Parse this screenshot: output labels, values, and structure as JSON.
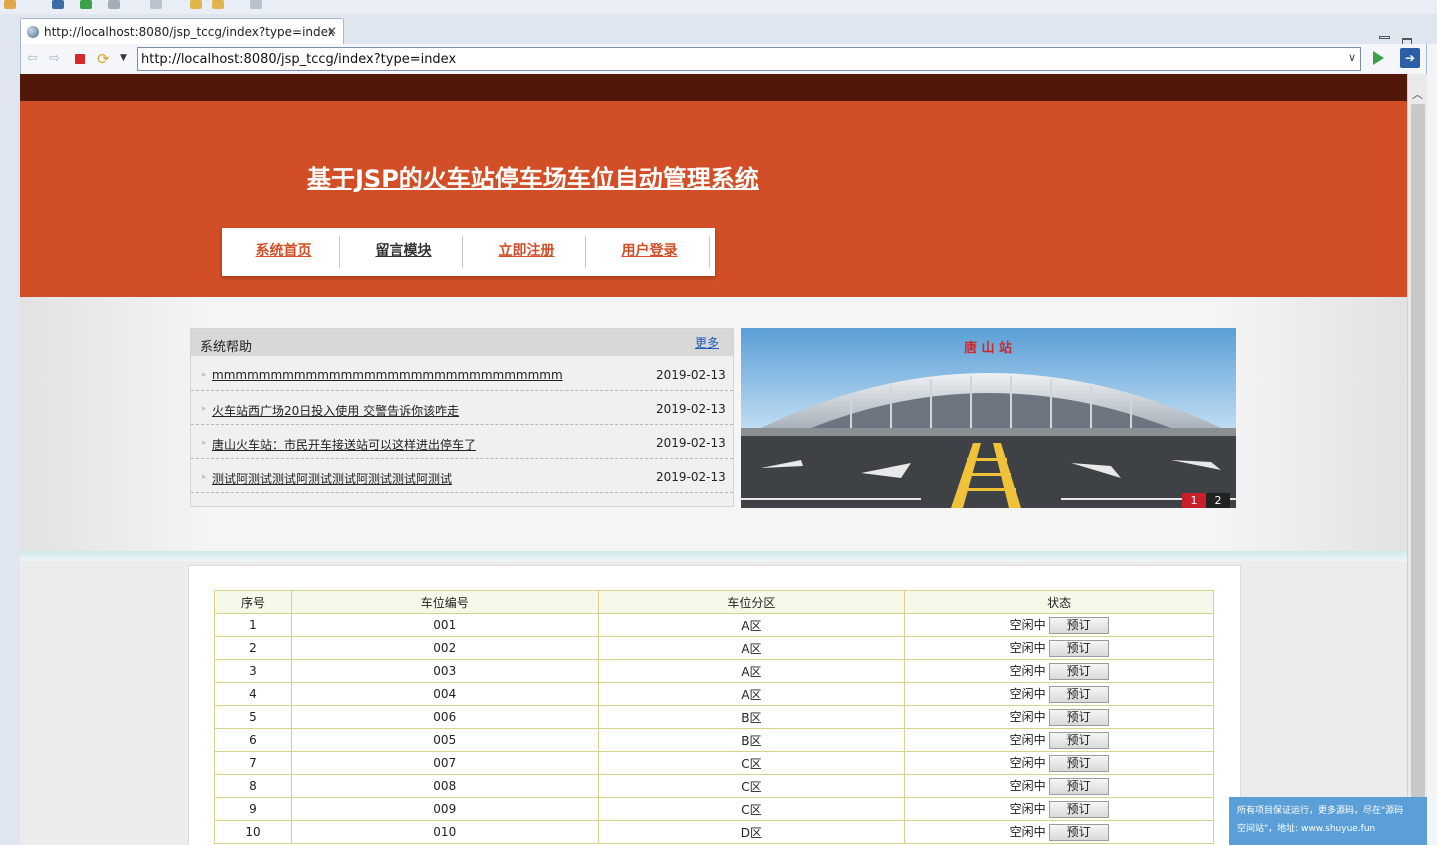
{
  "browser": {
    "tab_title": "http://localhost:8080/jsp_tccg/index?type=index",
    "url": "http://localhost:8080/jsp_tccg/index?type=index"
  },
  "site": {
    "title": "基于JSP的火车站停车场车位自动管理系统",
    "menu": [
      {
        "label": "系统首页",
        "color": "#d24e27"
      },
      {
        "label": "留言模块",
        "color": "#333333"
      },
      {
        "label": "立即注册",
        "color": "#d24e27"
      },
      {
        "label": "用户登录",
        "color": "#d24e27"
      }
    ]
  },
  "help": {
    "title": "系统帮助",
    "more": "更多",
    "items": [
      {
        "title": "mmmmmmmmmmmmmmmmmmmmmmmmmmmmmm",
        "date": "2019-02-13"
      },
      {
        "title": "火车站西广场20日投入使用 交警告诉你该咋走",
        "date": "2019-02-13"
      },
      {
        "title": "唐山火车站：市民开车接送站可以这样进出停车了",
        "date": "2019-02-13"
      },
      {
        "title": "测试阿测试测试阿测试测试阿测试测试阿测试",
        "date": "2019-02-13"
      }
    ]
  },
  "slideshow": {
    "station_sign": "唐 山 站",
    "pages": [
      "1",
      "2"
    ],
    "active_page": "1"
  },
  "table": {
    "headers": [
      "序号",
      "车位编号",
      "车位分区",
      "状态"
    ],
    "rows": [
      {
        "no": "1",
        "code": "001",
        "zone": "A区",
        "status": "空闲中"
      },
      {
        "no": "2",
        "code": "002",
        "zone": "A区",
        "status": "空闲中"
      },
      {
        "no": "3",
        "code": "003",
        "zone": "A区",
        "status": "空闲中"
      },
      {
        "no": "4",
        "code": "004",
        "zone": "A区",
        "status": "空闲中"
      },
      {
        "no": "5",
        "code": "006",
        "zone": "B区",
        "status": "空闲中"
      },
      {
        "no": "6",
        "code": "005",
        "zone": "B区",
        "status": "空闲中"
      },
      {
        "no": "7",
        "code": "007",
        "zone": "C区",
        "status": "空闲中"
      },
      {
        "no": "8",
        "code": "008",
        "zone": "C区",
        "status": "空闲中"
      },
      {
        "no": "9",
        "code": "009",
        "zone": "C区",
        "status": "空闲中"
      },
      {
        "no": "10",
        "code": "010",
        "zone": "D区",
        "status": "空闲中"
      }
    ],
    "book_label": "预订"
  },
  "ad": {
    "line1": "所有项目保证运行，更多源码，尽在\"源码",
    "line2": "空间站\"，地址: www.shuyue.fun"
  },
  "colors": {
    "header_bg": "#d24e27",
    "topband": "#511708",
    "link_blue": "#1a5ab8"
  }
}
